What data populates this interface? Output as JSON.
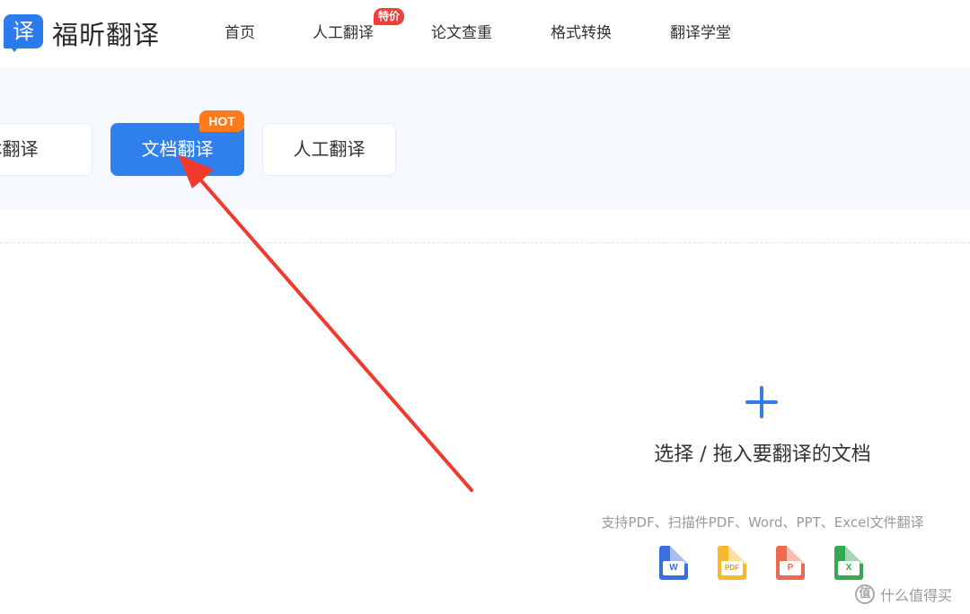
{
  "brand": {
    "logo_glyph": "译",
    "name": "福昕翻译",
    "color": "#2b7bef"
  },
  "nav": {
    "items": [
      {
        "label": "首页"
      },
      {
        "label": "人工翻译",
        "badge": "特价"
      },
      {
        "label": "论文查重"
      },
      {
        "label": "格式转换"
      },
      {
        "label": "翻译学堂"
      }
    ]
  },
  "tabs": [
    {
      "label": "文本翻译",
      "active": false
    },
    {
      "label": "文档翻译",
      "active": true,
      "badge": "HOT"
    },
    {
      "label": "人工翻译",
      "active": false
    }
  ],
  "upload": {
    "icon": "plus-icon",
    "title": "选择 / 拖入要翻译的文档",
    "subtitle": "支持PDF、扫描件PDF、Word、PPT、Excel文件翻译",
    "file_types": [
      {
        "icon": "word-file-icon",
        "label": "W",
        "color": "#3a6fe0"
      },
      {
        "icon": "pdf-file-icon",
        "label": "PDF",
        "color": "#f5b82e"
      },
      {
        "icon": "ppt-file-icon",
        "label": "P",
        "color": "#ee6a4f"
      },
      {
        "icon": "excel-file-icon",
        "label": "X",
        "color": "#34a853"
      }
    ]
  },
  "annotation": {
    "color": "#f03a2e"
  },
  "watermark": {
    "glyph": "值",
    "text": "什么值得买"
  },
  "colors": {
    "accent": "#2f80ed",
    "hot": "#ff7a1a",
    "badge_red": "#f23d3d",
    "band_bg": "#f5f8fc"
  }
}
